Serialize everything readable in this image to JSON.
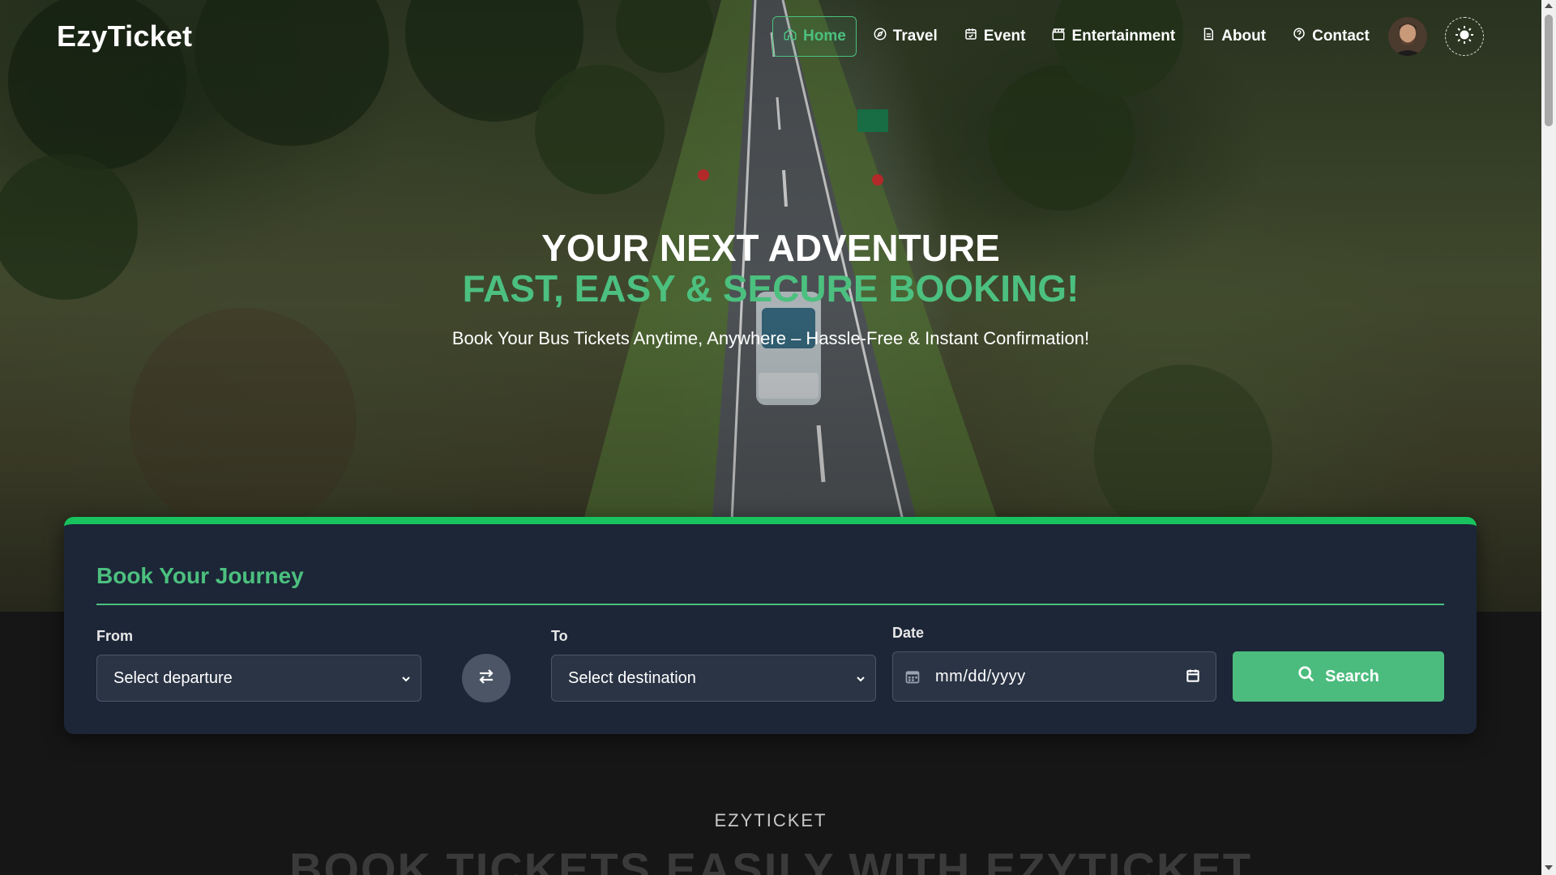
{
  "brand": {
    "logo": "EzyTicket"
  },
  "nav": {
    "items": [
      {
        "label": "Home",
        "icon": "home-icon",
        "active": true
      },
      {
        "label": "Travel",
        "icon": "compass-icon"
      },
      {
        "label": "Event",
        "icon": "calendar-icon"
      },
      {
        "label": "Entertainment",
        "icon": "clapperboard-icon"
      },
      {
        "label": "About",
        "icon": "document-icon"
      },
      {
        "label": "Contact",
        "icon": "help-circle-icon"
      }
    ],
    "avatar": "user-avatar",
    "theme_toggle": "sun-icon"
  },
  "hero": {
    "title": "YOUR NEXT ADVENTURE",
    "subtitle": "FAST, EASY & SECURE BOOKING!",
    "description": "Book Your Bus Tickets Anytime, Anywhere – Hassle-Free & Instant Confirmation!"
  },
  "booking": {
    "title": "Book Your Journey",
    "from_label": "From",
    "from_value": "Select departure",
    "to_label": "To",
    "to_value": "Select destination",
    "date_label": "Date",
    "date_placeholder": "mm/dd/yyyy",
    "search_label": "Search"
  },
  "section": {
    "kicker": "EZYTICKET",
    "heading": "BOOK TICKETS EASILY WITH EZYTICKET"
  },
  "colors": {
    "accent": "#4cc07f",
    "card_bg": "#1c2637",
    "card_top_border": "#18c25e",
    "page_bg": "#161616"
  }
}
